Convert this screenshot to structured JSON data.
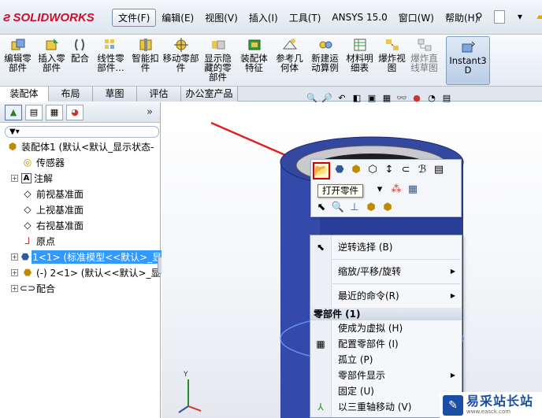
{
  "app": {
    "logo_text": "SOLIDWORKS"
  },
  "menu": [
    "文件(F)",
    "编辑(E)",
    "视图(V)",
    "插入(I)",
    "工具(T)",
    "ANSYS 15.0",
    "窗口(W)",
    "帮助(H)"
  ],
  "ribbon": [
    {
      "label": "编辑零部件",
      "icon": "edit-component-icon"
    },
    {
      "label": "插入零部件",
      "icon": "insert-component-icon"
    },
    {
      "label": "配合",
      "icon": "mate-icon"
    },
    {
      "label": "线性零部件…",
      "icon": "linear-pattern-icon"
    },
    {
      "label": "智能扣件",
      "icon": "smart-fasteners-icon"
    },
    {
      "label": "移动零部件",
      "icon": "move-component-icon"
    },
    {
      "label": "显示隐藏的零部件",
      "icon": "show-hidden-icon"
    },
    {
      "label": "装配体特征",
      "icon": "assembly-features-icon"
    },
    {
      "label": "参考几何体",
      "icon": "reference-geometry-icon"
    },
    {
      "label": "新建运动算例",
      "icon": "motion-study-icon"
    },
    {
      "label": "材料明细表",
      "icon": "bom-icon"
    },
    {
      "label": "爆炸视图",
      "icon": "exploded-view-icon"
    },
    {
      "label": "爆炸直线草图",
      "icon": "explode-line-icon"
    },
    {
      "label": "Instant3D",
      "icon": "instant3d-icon"
    }
  ],
  "cm_tabs": [
    "装配体",
    "布局",
    "草图",
    "评估",
    "办公室产品"
  ],
  "tree": {
    "root": "装配体1 (默认<默认_显示状态-",
    "items": [
      {
        "label": "传感器",
        "icon": "sensor-icon",
        "expand": false
      },
      {
        "label": "注解",
        "icon": "annotation-icon",
        "expand": true
      },
      {
        "label": "前视基准面",
        "icon": "plane-icon",
        "expand": false
      },
      {
        "label": "上视基准面",
        "icon": "plane-icon",
        "expand": false
      },
      {
        "label": "右视基准面",
        "icon": "plane-icon",
        "expand": false
      },
      {
        "label": "原点",
        "icon": "origin-icon",
        "expand": false
      },
      {
        "label": "1<1> (标准模型<<默认>_显",
        "icon": "part-icon",
        "expand": true,
        "selected": true
      },
      {
        "label": "(-) 2<1> (默认<<默认>_显",
        "icon": "part-icon",
        "expand": true
      },
      {
        "label": "配合",
        "icon": "mates-folder-icon",
        "expand": true
      }
    ]
  },
  "tooltip": "打开零件",
  "context_menu": {
    "reverse_select": "逆转选择 (B)",
    "zoom_pan_rotate": "缩放/平移/旋转",
    "recent_commands": "最近的命令(R)",
    "section_header": "零部件 (1)",
    "make_virtual": "使成为虚拟 (H)",
    "config_component": "配置零部件 (I)",
    "isolate": "孤立 (P)",
    "component_display": "零部件显示",
    "fix": "固定 (U)",
    "move_triad": "以三重轴移动 (V)"
  },
  "watermark": {
    "title": "易采站长站",
    "url": "www.easck.com"
  }
}
